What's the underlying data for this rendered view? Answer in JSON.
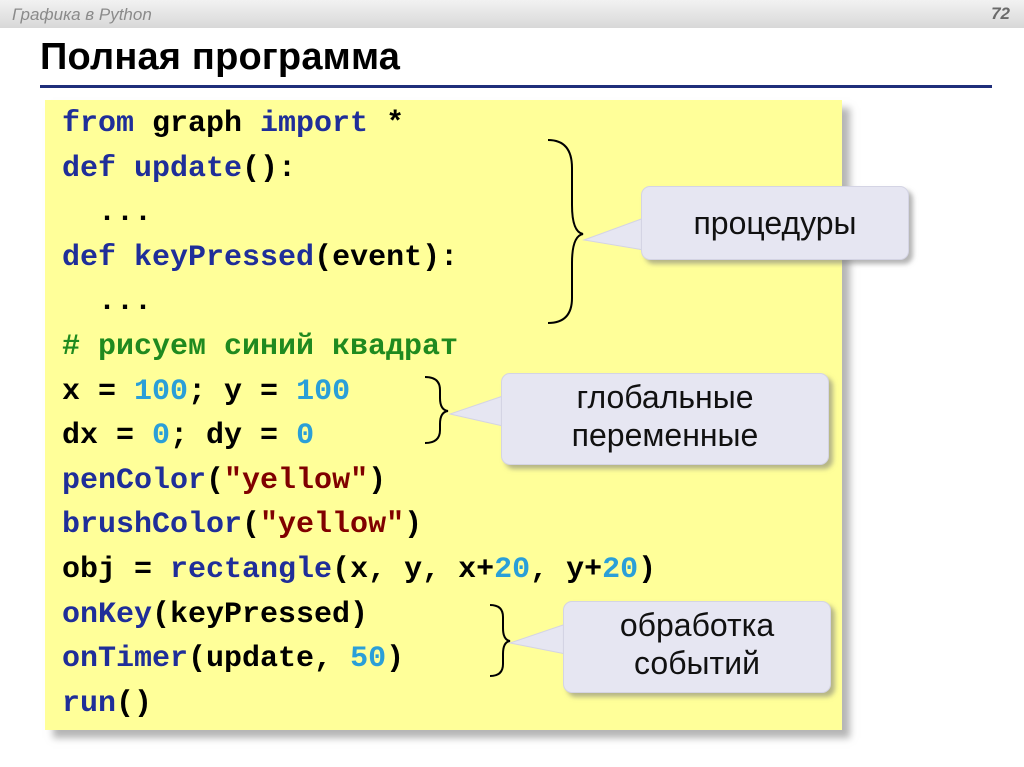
{
  "header": {
    "top_title": "Графика в Python",
    "page_number": "72"
  },
  "slide": {
    "title": "Полная программа"
  },
  "code": {
    "line1": {
      "kw1": "from",
      "mid": " graph ",
      "kw2": "import",
      "rest": " *"
    },
    "line2": {
      "kw": "def",
      "name": " update",
      "rest": "():"
    },
    "line3": {
      "text": "  ..."
    },
    "line4": {
      "kw": "def",
      "name": " keyPressed",
      "rest": "(event):"
    },
    "line5": {
      "text": "  ..."
    },
    "line6": {
      "comment": "# рисуем синий квадрат"
    },
    "line7": {
      "a": "x = ",
      "n1": "100",
      "b": "; y = ",
      "n2": "100"
    },
    "line8": {
      "a": "dx = ",
      "n1": "0",
      "b": "; dy = ",
      "n2": "0"
    },
    "line9": {
      "fn": "penColor",
      "p1": "(",
      "str": "\"yellow\"",
      "p2": ")"
    },
    "line10": {
      "fn": "brushColor",
      "p1": "(",
      "str": "\"yellow\"",
      "p2": ")"
    },
    "line11": {
      "a": "obj = ",
      "fn": "rectangle",
      "b": "(x, y, x+",
      "n1": "20",
      "c": ", y+",
      "n2": "20",
      "d": ")"
    },
    "line12": {
      "fn": "onKey",
      "rest": "(keyPressed)"
    },
    "line13": {
      "fn": "onTimer",
      "a": "(update, ",
      "n": "50",
      "b": ")"
    },
    "line14": {
      "fn": "run",
      "rest": "()"
    }
  },
  "callouts": {
    "procedures": "процедуры",
    "globals_line1": "глобальные",
    "globals_line2": "переменные",
    "events_line1": "обработка",
    "events_line2": "событий"
  },
  "colors": {
    "code_background": "#ffff99",
    "keyword": "#1f2e99",
    "number": "#2a9fd8",
    "string": "#800000",
    "comment": "#1f8a1f",
    "title_rule": "#1f2e7a",
    "callout_fill": "#e6e6f2"
  }
}
